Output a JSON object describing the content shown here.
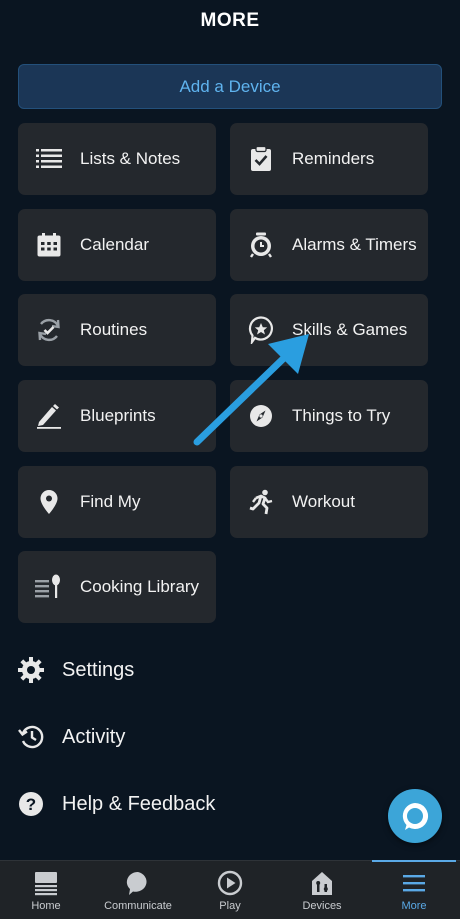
{
  "header": {
    "title": "MORE"
  },
  "add_device": {
    "label": "Add a Device"
  },
  "tiles": [
    {
      "label": "Lists & Notes",
      "icon": "list-icon"
    },
    {
      "label": "Reminders",
      "icon": "clipboard-check-icon"
    },
    {
      "label": "Calendar",
      "icon": "calendar-icon"
    },
    {
      "label": "Alarms & Timers",
      "icon": "alarm-clock-icon"
    },
    {
      "label": "Routines",
      "icon": "routines-icon"
    },
    {
      "label": "Skills & Games",
      "icon": "skills-star-icon"
    },
    {
      "label": "Blueprints",
      "icon": "pencil-icon"
    },
    {
      "label": "Things to Try",
      "icon": "compass-icon"
    },
    {
      "label": "Find My",
      "icon": "location-pin-icon"
    },
    {
      "label": "Workout",
      "icon": "running-person-icon"
    },
    {
      "label": "Cooking Library",
      "icon": "cooking-icon"
    }
  ],
  "list": [
    {
      "label": "Settings",
      "icon": "gear-icon"
    },
    {
      "label": "Activity",
      "icon": "history-icon"
    },
    {
      "label": "Help & Feedback",
      "icon": "help-icon"
    }
  ],
  "nav": [
    {
      "label": "Home",
      "icon": "home-icon"
    },
    {
      "label": "Communicate",
      "icon": "chat-bubble-icon"
    },
    {
      "label": "Play",
      "icon": "play-icon"
    },
    {
      "label": "Devices",
      "icon": "devices-icon"
    },
    {
      "label": "More",
      "icon": "menu-icon",
      "active": true
    }
  ],
  "colors": {
    "accent": "#5aa9e6",
    "arrow": "#2a9ee0",
    "tile": "#24282d",
    "background": "#0a1521"
  }
}
